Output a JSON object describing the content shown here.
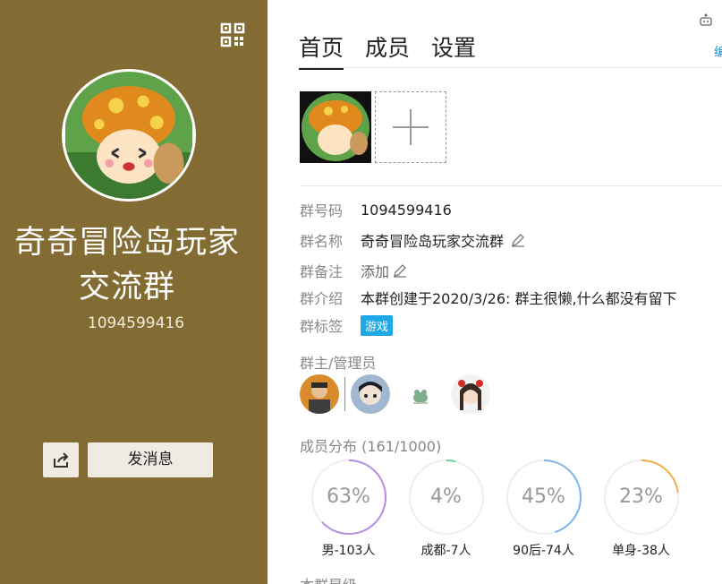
{
  "left": {
    "group_name_line1": "奇奇冒险岛玩家",
    "group_name_line2": "交流群",
    "group_id": "1094599416",
    "send_message_label": "发消息"
  },
  "tabs": [
    {
      "label": "首页",
      "active": true
    },
    {
      "label": "成员",
      "active": false
    },
    {
      "label": "设置",
      "active": false
    }
  ],
  "side_link": "编",
  "info": {
    "id_label": "群号码",
    "id_value": "1094599416",
    "name_label": "群名称",
    "name_value": "奇奇冒险岛玩家交流群",
    "remark_label": "群备注",
    "remark_value": "添加",
    "intro_label": "群介绍",
    "intro_value": "本群创建于2020/3/26:  群主很懒,什么都没有留下",
    "tag_label": "群标签",
    "tag_value": "游戏"
  },
  "admins_title": "群主/管理员",
  "distribution": {
    "title": "成员分布 (161/1000)",
    "items": [
      {
        "value": "63%",
        "label": "男-103人",
        "fraction": 0.63,
        "color": "#b48fe0"
      },
      {
        "value": "4%",
        "label": "成都-7人",
        "fraction": 0.04,
        "color": "#6fcf97"
      },
      {
        "value": "45%",
        "label": "90后-74人",
        "fraction": 0.45,
        "color": "#7eb6ea"
      },
      {
        "value": "23%",
        "label": "单身-38人",
        "fraction": 0.23,
        "color": "#f3b04a"
      }
    ]
  },
  "cut_title": "本群星级",
  "colors": {
    "left_bg": "#826c34",
    "tag_bg": "#1fa8e6"
  }
}
